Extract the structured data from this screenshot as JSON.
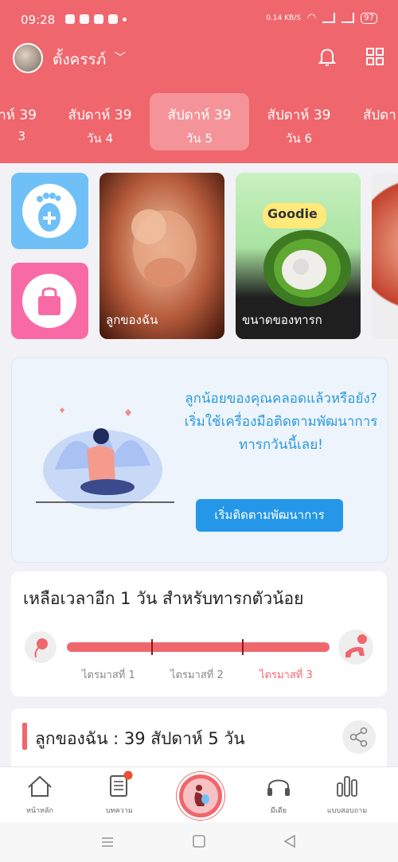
{
  "status_bar": {
    "time": "09:28",
    "speed": "0.14 KB/S",
    "battery": "97"
  },
  "header": {
    "user_name": "ตั้งครรภ์"
  },
  "tabs": [
    {
      "week": "าห์ 39",
      "day": "3"
    },
    {
      "week": "สัปดาห์ 39",
      "day": "วัน 4"
    },
    {
      "week": "สัปดาห์ 39",
      "day": "วัน 5"
    },
    {
      "week": "สัปดาห์ 39",
      "day": "วัน 6"
    },
    {
      "week": "สัปดา",
      "day": ""
    }
  ],
  "tiles": {
    "baby_label": "ลูกของฉัน",
    "size_label": "ขนาดของทารก",
    "goodie": "Goodie"
  },
  "promo": {
    "text": "ลูกน้อยของคุณคลอดแล้วหรือยัง? เริ่มใช้เครื่องมือติดตามพัฒนาการทารกวันนี้เลย!",
    "button": "เริ่มติดตามพัฒนาการ"
  },
  "countdown": {
    "text": "เหลือเวลาอีก 1 วัน สำหรับทารกตัวน้อย",
    "trimesters": [
      "ไตรมาสที่ 1",
      "ไตรมาสที่ 2",
      "ไตรมาสที่ 3"
    ],
    "active_trimester": 3
  },
  "baby_section": {
    "title": "ลูกของฉัน : 39 สัปดาห์ 5  วัน"
  },
  "bottom_nav": [
    {
      "label": "หน้าหลัก",
      "icon": "home-icon"
    },
    {
      "label": "บทความ",
      "icon": "article-icon"
    },
    {
      "label": "",
      "icon": "pregnancy-icon"
    },
    {
      "label": "มีเดีย",
      "icon": "headphones-icon"
    },
    {
      "label": "แบบสอบถาม",
      "icon": "poll-icon"
    }
  ],
  "colors": {
    "accent": "#f0666d",
    "blue": "#2497e8"
  }
}
